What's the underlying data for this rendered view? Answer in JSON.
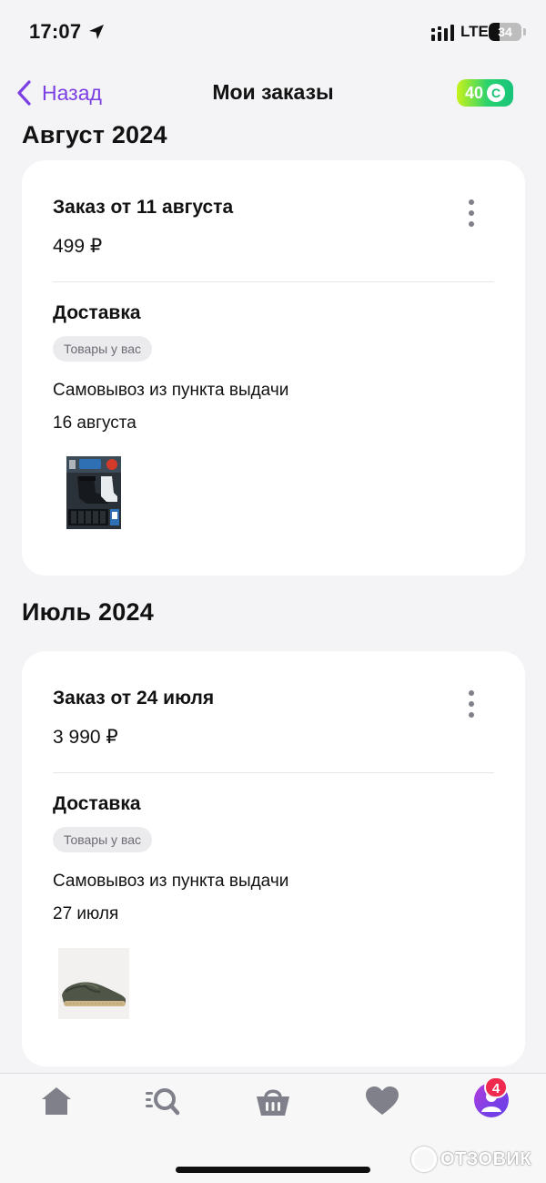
{
  "status_bar": {
    "time": "17:07",
    "network": "LTE",
    "battery": "34",
    "battery_fraction": 0.34
  },
  "header": {
    "back_label": "Назад",
    "title": "Мои заказы",
    "bonus_amount": "40",
    "bonus_icon_glyph": "С",
    "accent_color": "#7b3fe4"
  },
  "months": [
    {
      "heading": "Август 2024",
      "order": {
        "title": "Заказ от 11 августа",
        "price": "499 ₽",
        "delivery_title": "Доставка",
        "status_badge": "Товары у вас",
        "pickup_label": "Самовывоз из пункта выдачи",
        "pickup_date": "16 августа",
        "product_icon": "socks-product-icon"
      }
    },
    {
      "heading": "Июль 2024",
      "order": {
        "title": "Заказ от 24 июля",
        "price": "3 990 ₽",
        "delivery_title": "Доставка",
        "status_badge": "Товары у вас",
        "pickup_label": "Самовывоз из пункта выдачи",
        "pickup_date": "27 июля",
        "product_icon": "slip-on-shoe-product-icon"
      }
    }
  ],
  "tab_bar": {
    "tabs": [
      "home-icon",
      "catalog-search-icon",
      "cart-icon",
      "favorites-heart-icon",
      "profile-icon"
    ],
    "profile_badge": "4",
    "icon_color": "#7f8089"
  },
  "watermark": {
    "text": "ОТЗОВИК"
  }
}
